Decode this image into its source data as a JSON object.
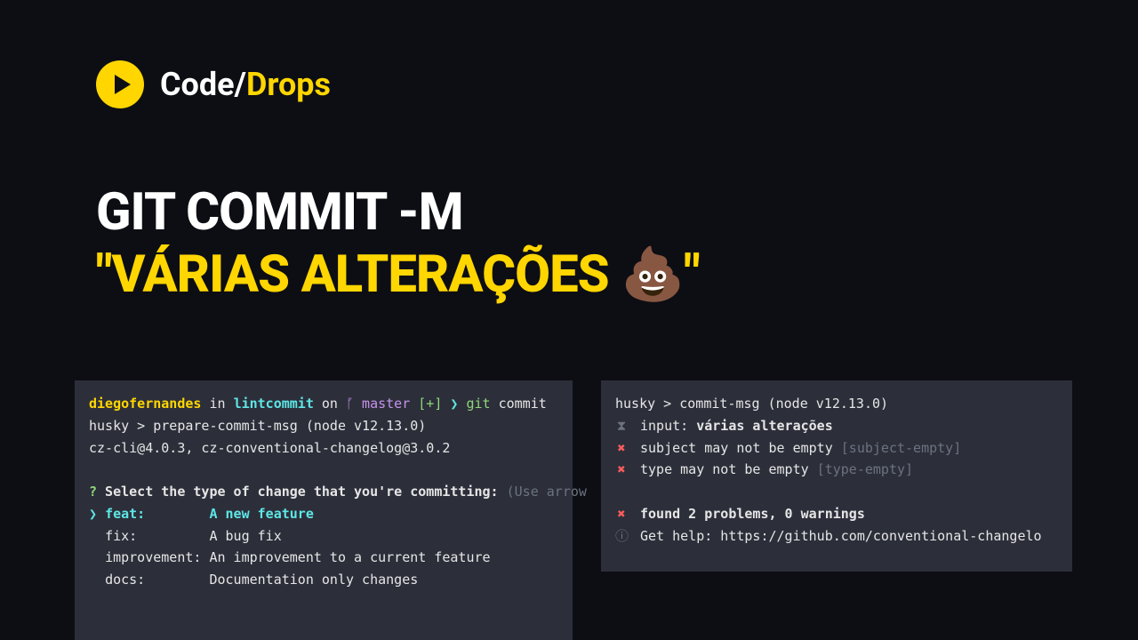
{
  "logo": {
    "code": "Code/",
    "drops": "Drops"
  },
  "title": {
    "line1": "GIT COMMIT -M",
    "line2": "\"VÁRIAS ALTERAÇÕES 💩\""
  },
  "leftTerm": {
    "prompt": {
      "user": "diegofernandes",
      "in": " in ",
      "dir": "lintcommit",
      "on": " on ",
      "branchGlyph": "ᚵ",
      "branch": " master ",
      "status": "[+]",
      "arrow": " ❯ ",
      "cmd1": "git",
      "cmd2": " commit"
    },
    "husky": "husky > prepare-commit-msg (node v12.13.0)",
    "czLine": "cz-cli@4.0.3, cz-conventional-changelog@3.0.2",
    "question": {
      "q": "?",
      "text": " Select the type of change that you're committing: ",
      "hint": "(Use arrow"
    },
    "options": [
      {
        "arrow": "❯ ",
        "key": "feat:",
        "pad": "        ",
        "desc": "A new feature",
        "selected": true
      },
      {
        "arrow": "  ",
        "key": "fix:",
        "pad": "         ",
        "desc": "A bug fix",
        "selected": false
      },
      {
        "arrow": "  ",
        "key": "improvement:",
        "pad": " ",
        "desc": "An improvement to a current feature",
        "selected": false
      },
      {
        "arrow": "  ",
        "key": "docs:",
        "pad": "        ",
        "desc": "Documentation only changes",
        "selected": false
      }
    ]
  },
  "rightTerm": {
    "header": "husky > commit-msg (node v12.13.0)",
    "input": {
      "mark": "⧗",
      "label": "input: ",
      "value": "várias alterações"
    },
    "errors": [
      {
        "mark": "✖",
        "text": "subject may not be empty ",
        "rule": "[subject-empty]"
      },
      {
        "mark": "✖",
        "text": "type may not be empty ",
        "rule": "[type-empty]"
      }
    ],
    "summary": {
      "mark": "✖",
      "text": "found 2 problems, 0 warnings"
    },
    "help": {
      "mark": "ⓘ",
      "text": "Get help: https://github.com/conventional-changelo"
    }
  }
}
